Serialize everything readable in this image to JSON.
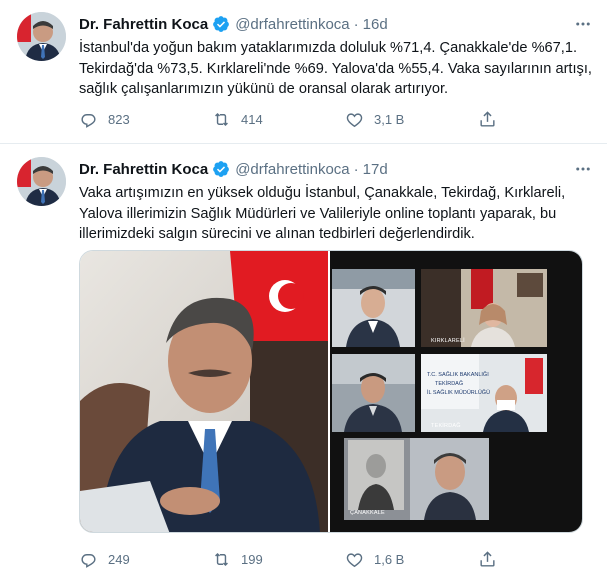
{
  "tweets": [
    {
      "name": "Dr. Fahrettin Koca",
      "handle": "@drfahrettinkoca",
      "separator": "·",
      "time": "16d",
      "text": "İstanbul'da yoğun bakım yataklarımızda doluluk %71,4. Çanakkale'de %67,1. Tekirdağ'da %73,5. Kırklareli'nde %69. Yalova'da %55,4. Vaka sayılarının artışı, sağlık çalışanlarımızın yükünü de oransal olarak artırıyor.",
      "replies": "823",
      "retweets": "414",
      "likes": "3,1 B"
    },
    {
      "name": "Dr. Fahrettin Koca",
      "handle": "@drfahrettinkoca",
      "separator": "·",
      "time": "17d",
      "text": "Vaka artışımızın en yüksek olduğu İstanbul, Çanakkale, Tekirdağ, Kırklareli, Yalova illerimizin Sağlık Müdürleri ve Valileriyle online toplantı yaparak, bu illerimizdeki salgın sürecini ve alınan tedbirleri değerlendirdik.",
      "replies": "249",
      "retweets": "199",
      "likes": "1,6 B",
      "media": {
        "caption_kirklareli": "KIRKLARELİ",
        "caption_tekirdag": "TEKİRDAĞ",
        "caption_canakkale": "ÇANAKKALE",
        "sign_line1": "T.C. SAĞLIK BAKANLIĞI",
        "sign_line2": "TEKİRDAĞ",
        "sign_line3": "İL SAĞLIK MÜDÜRLÜĞÜ"
      }
    }
  ],
  "colors": {
    "text_primary": "#0f1419",
    "text_secondary": "#5b7083",
    "verified_blue": "#1da1f2",
    "divider": "#e6ecf0"
  },
  "icons": [
    "verified-badge-icon",
    "more-icon",
    "reply-icon",
    "retweet-icon",
    "like-icon",
    "share-icon"
  ]
}
